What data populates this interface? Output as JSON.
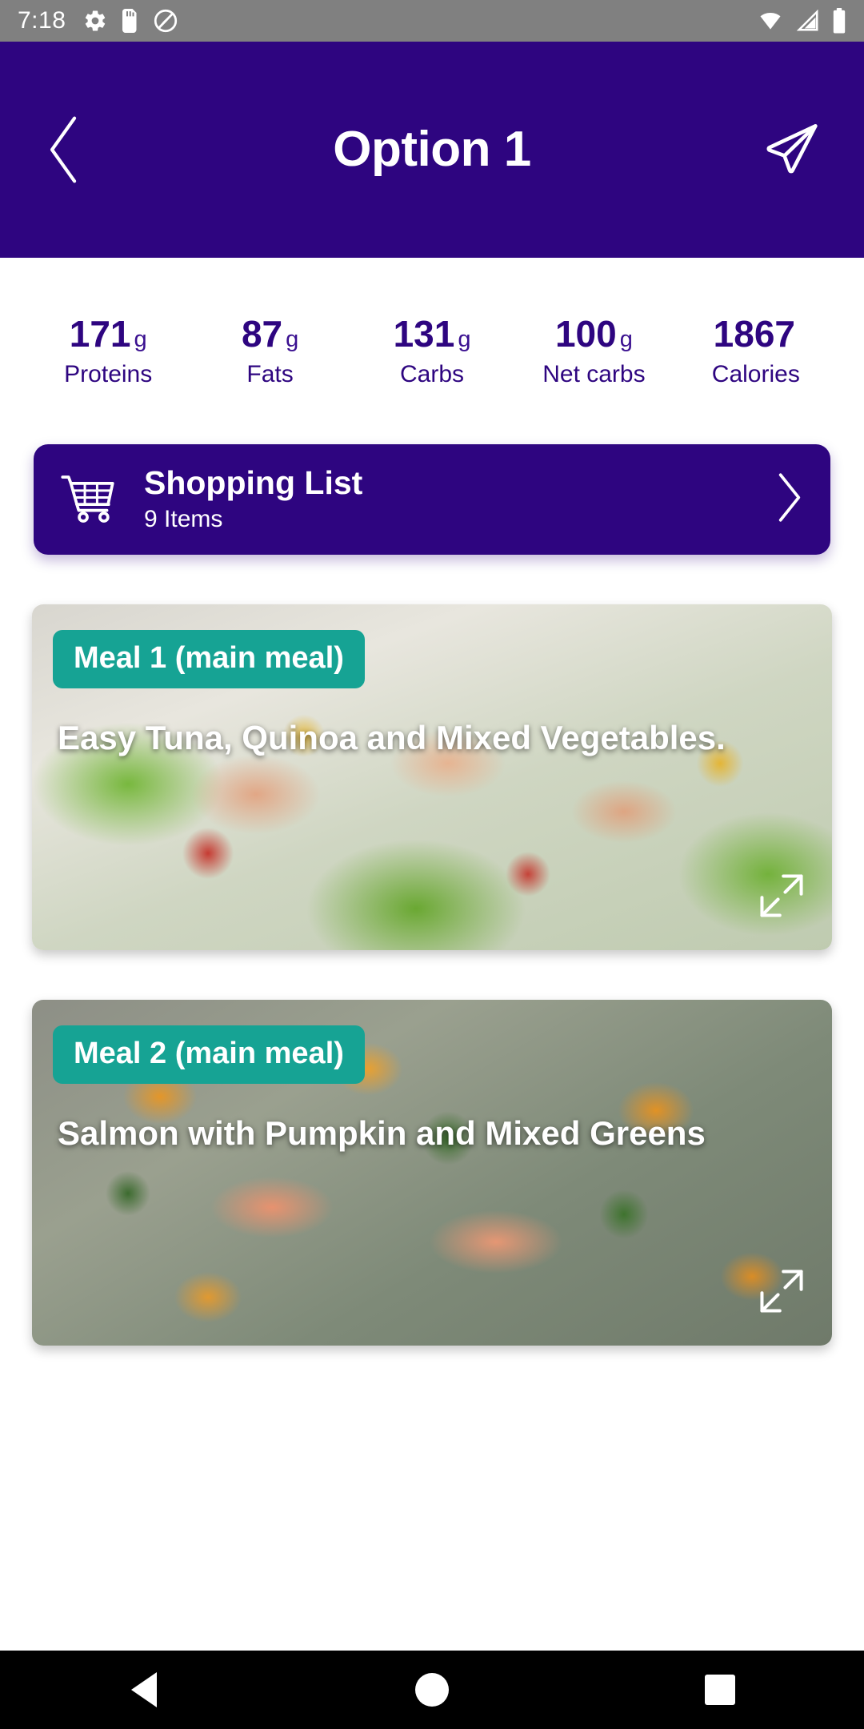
{
  "statusbar": {
    "time": "7:18",
    "left_icons": [
      "gear-icon",
      "sd-card-icon",
      "location-off-icon"
    ],
    "right_icons": [
      "wifi-icon",
      "signal-icon",
      "battery-icon"
    ]
  },
  "header": {
    "title": "Option 1",
    "back_icon": "chevron-left-icon",
    "send_icon": "send-plane-icon",
    "background_color": "#2E0580"
  },
  "nutrition": {
    "items": [
      {
        "value": "171",
        "unit": "g",
        "label": "Proteins"
      },
      {
        "value": "87",
        "unit": "g",
        "label": "Fats"
      },
      {
        "value": "131",
        "unit": "g",
        "label": "Carbs"
      },
      {
        "value": "100",
        "unit": "g",
        "label": "Net carbs"
      },
      {
        "value": "1867",
        "unit": "",
        "label": "Calories"
      }
    ],
    "text_color": "#2E0580"
  },
  "shopping_list": {
    "title": "Shopping List",
    "subtitle": "9 Items",
    "cart_icon": "shopping-cart-icon",
    "chevron_icon": "chevron-right-icon",
    "background_color": "#2E0580"
  },
  "meals": [
    {
      "badge": "Meal 1 (main meal)",
      "title": "Easy Tuna, Quinoa and Mixed Vegetables.",
      "expand_icon": "expand-icon",
      "badge_color": "#16A394"
    },
    {
      "badge": "Meal 2 (main meal)",
      "title": "Salmon with Pumpkin and Mixed Greens",
      "expand_icon": "expand-icon",
      "badge_color": "#16A394"
    }
  ],
  "navbar": {
    "back_icon": "nav-back-triangle-icon",
    "home_icon": "nav-home-circle-icon",
    "recents_icon": "nav-recents-square-icon"
  }
}
